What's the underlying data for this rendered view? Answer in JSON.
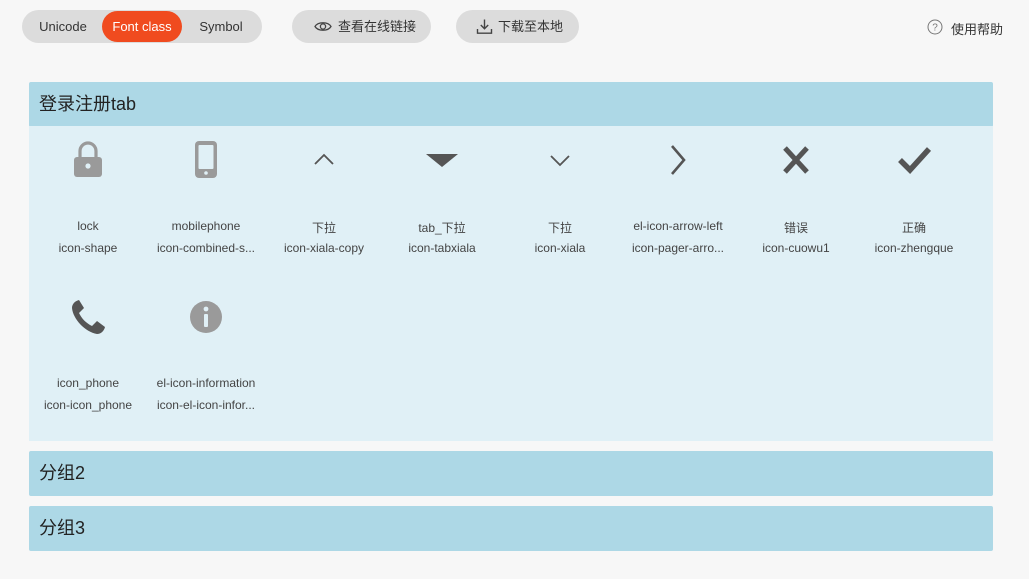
{
  "toolbar": {
    "tabs": [
      {
        "label": "Unicode",
        "active": false
      },
      {
        "label": "Font class",
        "active": true
      },
      {
        "label": "Symbol",
        "active": false
      }
    ],
    "view_online_link": {
      "label": "查看在线链接",
      "icon": "eye-icon"
    },
    "download_local": {
      "label": "下载至本地",
      "icon": "download-icon"
    },
    "help": {
      "label": "使用帮助",
      "icon": "help-circle-icon"
    }
  },
  "groups": [
    {
      "title": "登录注册tab",
      "expanded": true,
      "icons": [
        {
          "name": "lock",
          "class": "icon-shape",
          "glyph": "lock-icon"
        },
        {
          "name": "mobilephone",
          "class": "icon-combined-s...",
          "glyph": "mobilephone-icon"
        },
        {
          "name": "下拉",
          "class": "icon-xiala-copy",
          "glyph": "chevron-up-icon"
        },
        {
          "name": "tab_下拉",
          "class": "icon-tabxiala",
          "glyph": "triangle-down-icon"
        },
        {
          "name": "下拉",
          "class": "icon-xiala",
          "glyph": "chevron-down-icon"
        },
        {
          "name": "el-icon-arrow-left",
          "class": "icon-pager-arro...",
          "glyph": "chevron-right-icon"
        },
        {
          "name": "错误",
          "class": "icon-cuowu1",
          "glyph": "close-icon"
        },
        {
          "name": "正确",
          "class": "icon-zhengque",
          "glyph": "check-icon"
        },
        {
          "name": "icon_phone",
          "class": "icon-icon_phone",
          "glyph": "phone-icon"
        },
        {
          "name": "el-icon-information",
          "class": "icon-el-icon-infor...",
          "glyph": "info-icon"
        }
      ]
    },
    {
      "title": "分组2",
      "expanded": false,
      "icons": []
    },
    {
      "title": "分组3",
      "expanded": false,
      "icons": []
    }
  ],
  "colors": {
    "accent": "#f04b1f",
    "group_header": "#add8e6",
    "group_body": "#e0f0f6",
    "icon_dark": "#555555",
    "icon_light": "#9a9a9a",
    "button_bg": "#dcdcdc"
  }
}
